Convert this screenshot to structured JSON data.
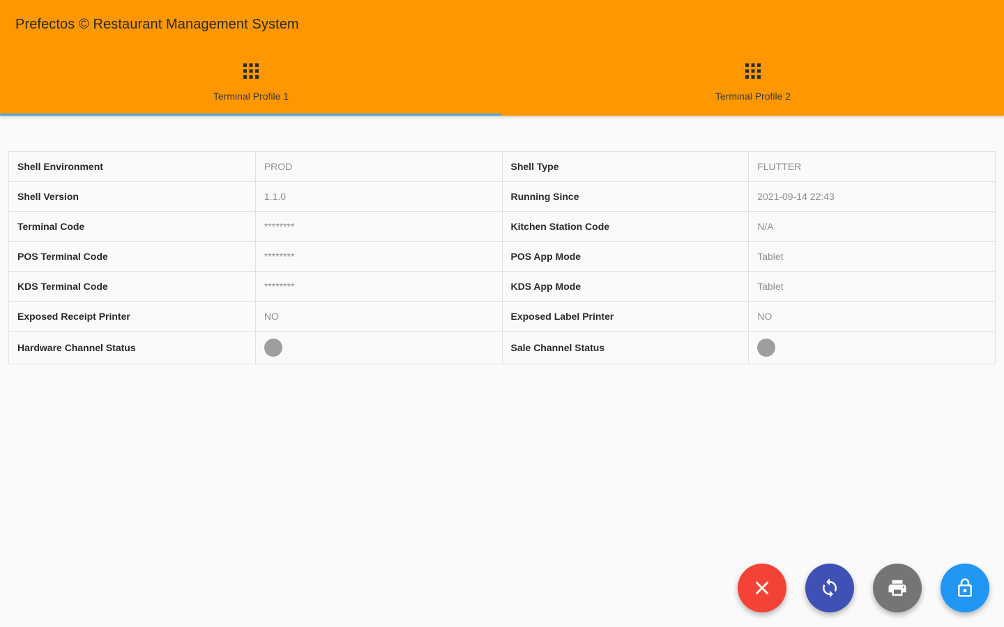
{
  "app": {
    "title": "Prefectos © Restaurant Management System"
  },
  "tabs": [
    {
      "label": "Terminal Profile 1",
      "icon": "apps-grid-icon",
      "active": true
    },
    {
      "label": "Terminal Profile 2",
      "icon": "apps-grid-icon",
      "active": false
    }
  ],
  "info": {
    "rows": [
      {
        "label_left": "Shell Environment",
        "value_left": "PROD",
        "label_right": "Shell Type",
        "value_right": "FLUTTER"
      },
      {
        "label_left": "Shell Version",
        "value_left": "1.1.0",
        "label_right": "Running Since",
        "value_right": "2021-09-14 22:43"
      },
      {
        "label_left": "Terminal Code",
        "value_left": "********",
        "label_right": "Kitchen Station Code",
        "value_right": "N/A"
      },
      {
        "label_left": "POS Terminal Code",
        "value_left": "********",
        "label_right": "POS App Mode",
        "value_right": "Tablet"
      },
      {
        "label_left": "KDS Terminal Code",
        "value_left": "********",
        "label_right": "KDS App Mode",
        "value_right": "Tablet"
      },
      {
        "label_left": "Exposed Receipt Printer",
        "value_left": "NO",
        "label_right": "Exposed Label Printer",
        "value_right": "NO"
      },
      {
        "label_left": "Hardware Channel Status",
        "label_right": "Sale Channel Status"
      }
    ],
    "status_dot_color": "#9e9e9e"
  },
  "actions": [
    {
      "icon": "close-icon",
      "color": "#f44336"
    },
    {
      "icon": "sync-icon",
      "color": "#3f51b5"
    },
    {
      "icon": "printer-icon",
      "color": "#757575"
    },
    {
      "icon": "lock-icon",
      "color": "#2196f3"
    }
  ],
  "colors": {
    "app_bar": "#ff9800",
    "tab_indicator": "#4fa6d9"
  }
}
